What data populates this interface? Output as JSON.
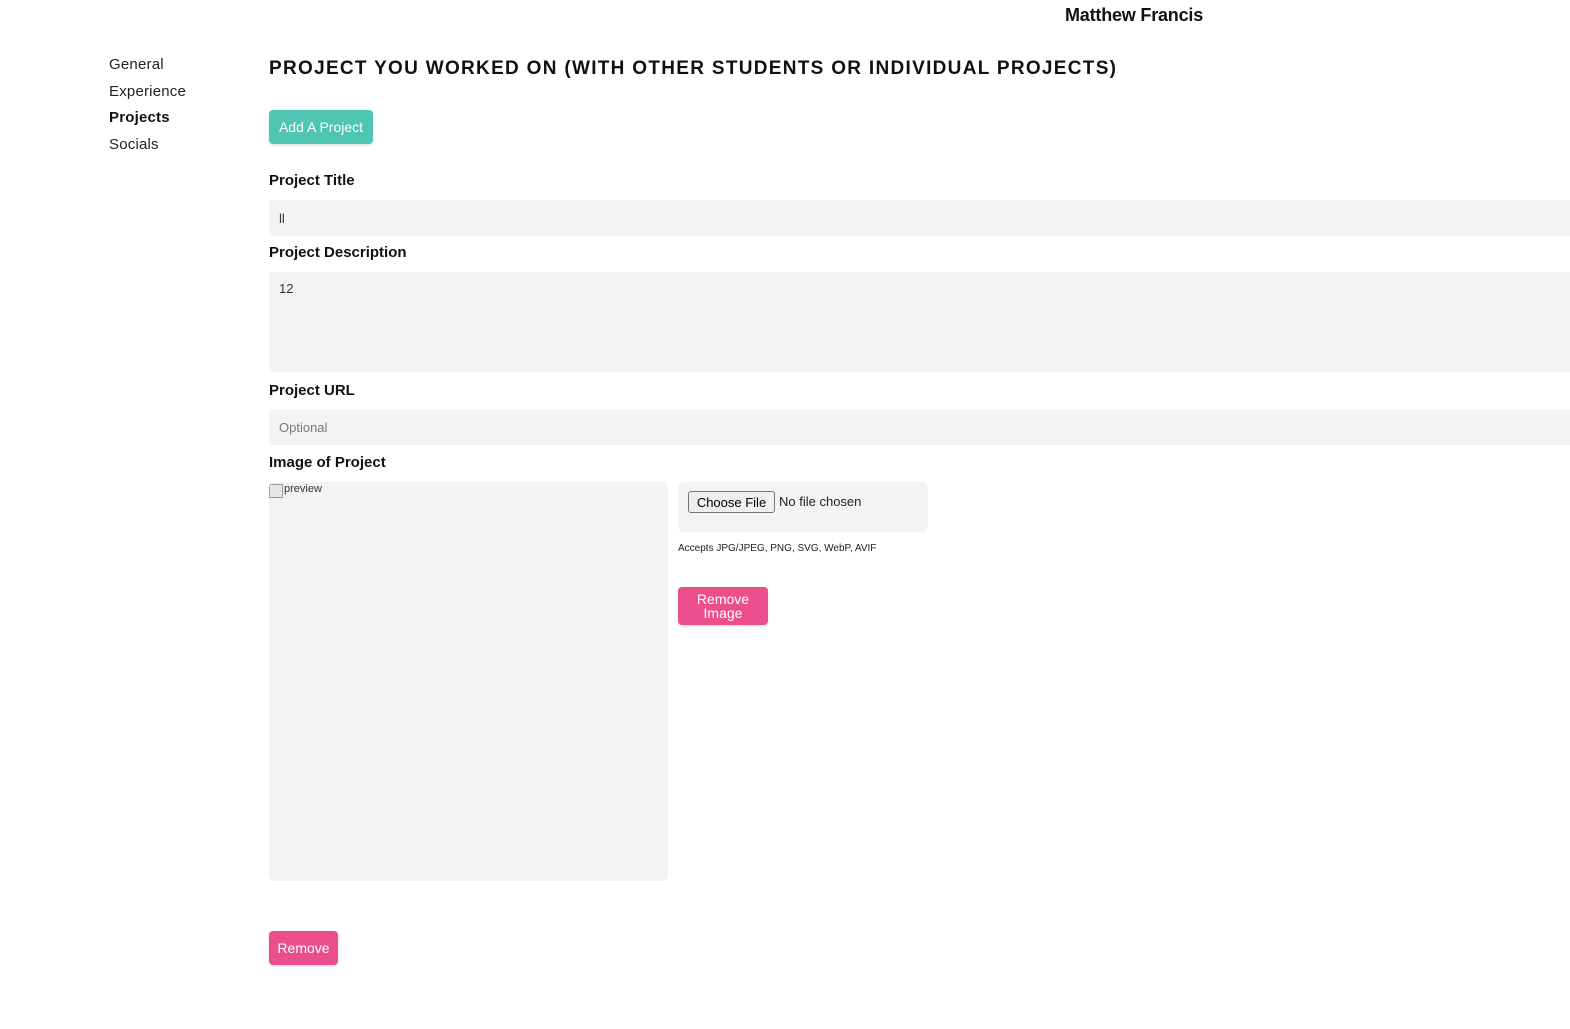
{
  "header": {
    "user_name": "Matthew Francis"
  },
  "sidebar": {
    "items": [
      {
        "label": "General",
        "active": false
      },
      {
        "label": "Experience",
        "active": false
      },
      {
        "label": "Projects",
        "active": true
      },
      {
        "label": "Socials",
        "active": false
      }
    ]
  },
  "main": {
    "section_title": "PROJECT YOU WORKED ON (WITH OTHER STUDENTS OR INDIVIDUAL PROJECTS)",
    "add_button_label": "Add A Project",
    "project_title": {
      "label": "Project Title",
      "value": "ll"
    },
    "project_description": {
      "label": "Project Description",
      "value": "12"
    },
    "project_url": {
      "label": "Project URL",
      "value": "",
      "placeholder": "Optional"
    },
    "image": {
      "label": "Image of Project",
      "preview_alt": "preview",
      "choose_file_label": "Choose File",
      "file_status": "No file chosen",
      "accepts_text": "Accepts JPG/JPEG, PNG, SVG, WebP, AVIF",
      "remove_image_label": "Remove Image"
    },
    "remove_button_label": "Remove"
  },
  "colors": {
    "accent_teal": "#4ec6b3",
    "accent_pink": "#ea4f8c",
    "field_background": "#f2f3f2"
  }
}
